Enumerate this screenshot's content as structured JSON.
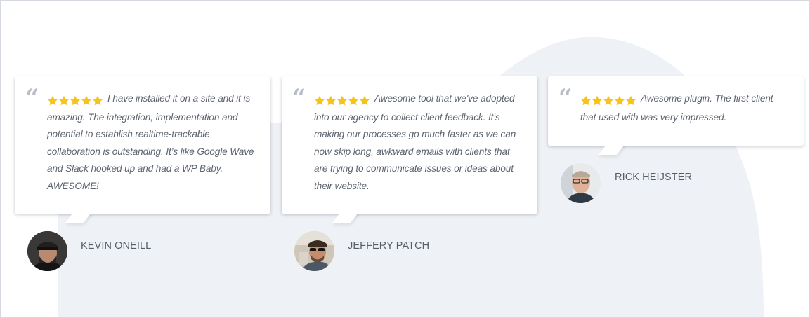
{
  "colors": {
    "background": "#ffffff",
    "blob": "#eef1f5",
    "card": "#ffffff",
    "star": "#f6c419",
    "review_text": "#5c6470",
    "author_text": "#555d68",
    "quote_mark": "#b9bec6"
  },
  "testimonials": [
    {
      "quote_icon": "quote-icon",
      "rating": 5,
      "text": "I have installed it on a site and it is amazing. The integration, implementation and potential to establish realtime-trackable collaboration is outstanding. It’s like Google Wave and Slack hooked up and had a WP Baby. AWESOME!",
      "author": "KEVIN ONEILL",
      "avatar": "avatar-kevin-oneill"
    },
    {
      "quote_icon": "quote-icon",
      "rating": 5,
      "text": "Awesome tool that we've adopted into our agency to collect client feedback. It's making our processes go much faster as we can now skip long, awkward emails with clients that are trying to communicate issues or ideas about their website.",
      "author": "JEFFERY PATCH",
      "avatar": "avatar-jeffery-patch"
    },
    {
      "quote_icon": "quote-icon",
      "rating": 5,
      "text": "Awesome plugin. The first client that used with was very impressed.",
      "author": "RICK HEIJSTER",
      "avatar": "avatar-rick-heijster"
    }
  ]
}
